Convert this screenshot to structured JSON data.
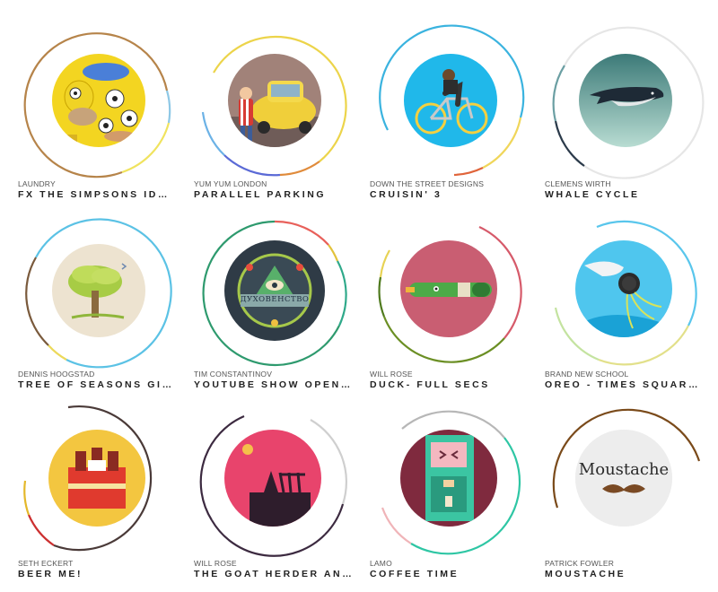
{
  "colors": {
    "background": "#ffffff",
    "studio_text": "#555555",
    "title_text": "#222222"
  },
  "cards": [
    {
      "studio": "LAUNDRY",
      "title": "FX THE SIMPSONS ID…",
      "thumb_icon": "simpsons-thumbnail"
    },
    {
      "studio": "YUM YUM LONDON",
      "title": "PARALLEL PARKING",
      "thumb_icon": "parking-car-thumbnail"
    },
    {
      "studio": "DOWN THE STREET DESIGNS",
      "title": "CRUISIN' 3",
      "thumb_icon": "cyclist-thumbnail"
    },
    {
      "studio": "CLEMENS WIRTH",
      "title": "WHALE CYCLE",
      "thumb_icon": "whale-thumbnail"
    },
    {
      "studio": "DENNIS HOOGSTAD",
      "title": "TREE OF SEASONS GI…",
      "thumb_icon": "tree-thumbnail"
    },
    {
      "studio": "TIM CONSTANTINOV",
      "title": "YOUTUBE SHOW OPEN…",
      "thumb_icon": "badge-thumbnail",
      "badge_text": "ДУХОВЕНСТВО"
    },
    {
      "studio": "WILL ROSE",
      "title": "DUCK- FULL SECS",
      "thumb_icon": "duck-thumbnail"
    },
    {
      "studio": "BRAND NEW SCHOOL",
      "title": "OREO - TIMES SQUAR…",
      "thumb_icon": "oreo-hand-thumbnail"
    },
    {
      "studio": "SETH ECKERT",
      "title": "BEER ME!",
      "thumb_icon": "beer-pack-thumbnail"
    },
    {
      "studio": "WILL ROSE",
      "title": "THE GOAT HERDER AN…",
      "thumb_icon": "goat-herder-thumbnail"
    },
    {
      "studio": "LAMO",
      "title": "COFFEE TIME",
      "thumb_icon": "coffee-machine-thumbnail"
    },
    {
      "studio": "PATRICK FOWLER",
      "title": "MOUSTACHE",
      "thumb_icon": "moustache-thumbnail",
      "thumb_text": "Moustache"
    }
  ]
}
